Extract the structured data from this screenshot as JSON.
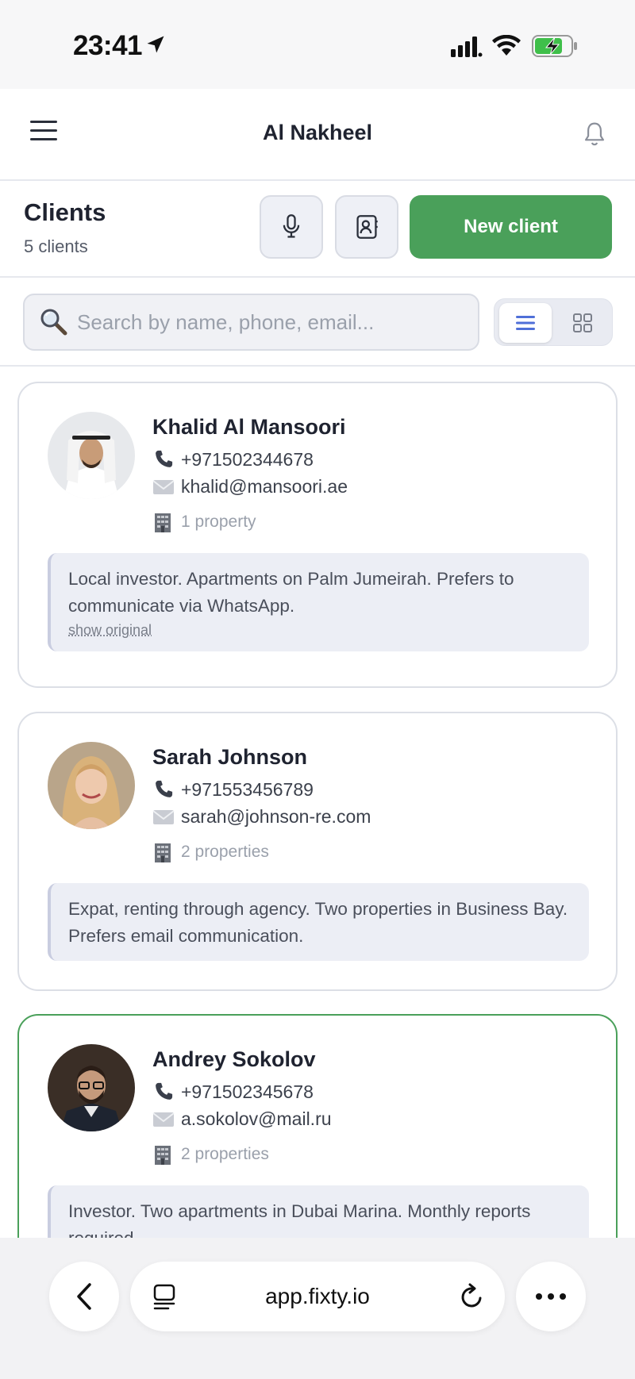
{
  "status_bar": {
    "time": "23:41"
  },
  "app": {
    "title": "Al Nakheel"
  },
  "header": {
    "title": "Clients",
    "count": "5 clients",
    "new_client_label": "New client"
  },
  "search": {
    "placeholder": "Search by name, phone, email..."
  },
  "view_mode": "list",
  "clients": [
    {
      "name": "Khalid Al Mansoori",
      "phone": "+971502344678",
      "email": "khalid@mansoori.ae",
      "properties": "1 property",
      "note": "Local investor. Apartments on Palm Jumeirah. Prefers to communicate via WhatsApp.",
      "show_original": "show original"
    },
    {
      "name": "Sarah Johnson",
      "phone": "+971553456789",
      "email": "sarah@johnson-re.com",
      "properties": "2 properties",
      "note": "Expat, renting through agency. Two properties in Business Bay. Prefers email communication."
    },
    {
      "name": "Andrey Sokolov",
      "phone": "+971502345678",
      "email": "a.sokolov@mail.ru",
      "properties": "2 properties",
      "note": "Investor. Two apartments in Dubai Marina. Monthly reports required."
    }
  ],
  "browser": {
    "url": "app.fixty.io"
  },
  "colors": {
    "accent_green": "#4aa05a",
    "selected_border": "#4aa05a",
    "toggle_active": "#4f6fd8"
  },
  "icons": {
    "phone": "phone-icon",
    "email": "envelope-icon",
    "properties": "building-icon",
    "search": "magnifier-icon",
    "mic": "microphone-icon",
    "contacts": "contact-card-icon",
    "bell": "bell-icon",
    "menu": "hamburger-icon"
  }
}
